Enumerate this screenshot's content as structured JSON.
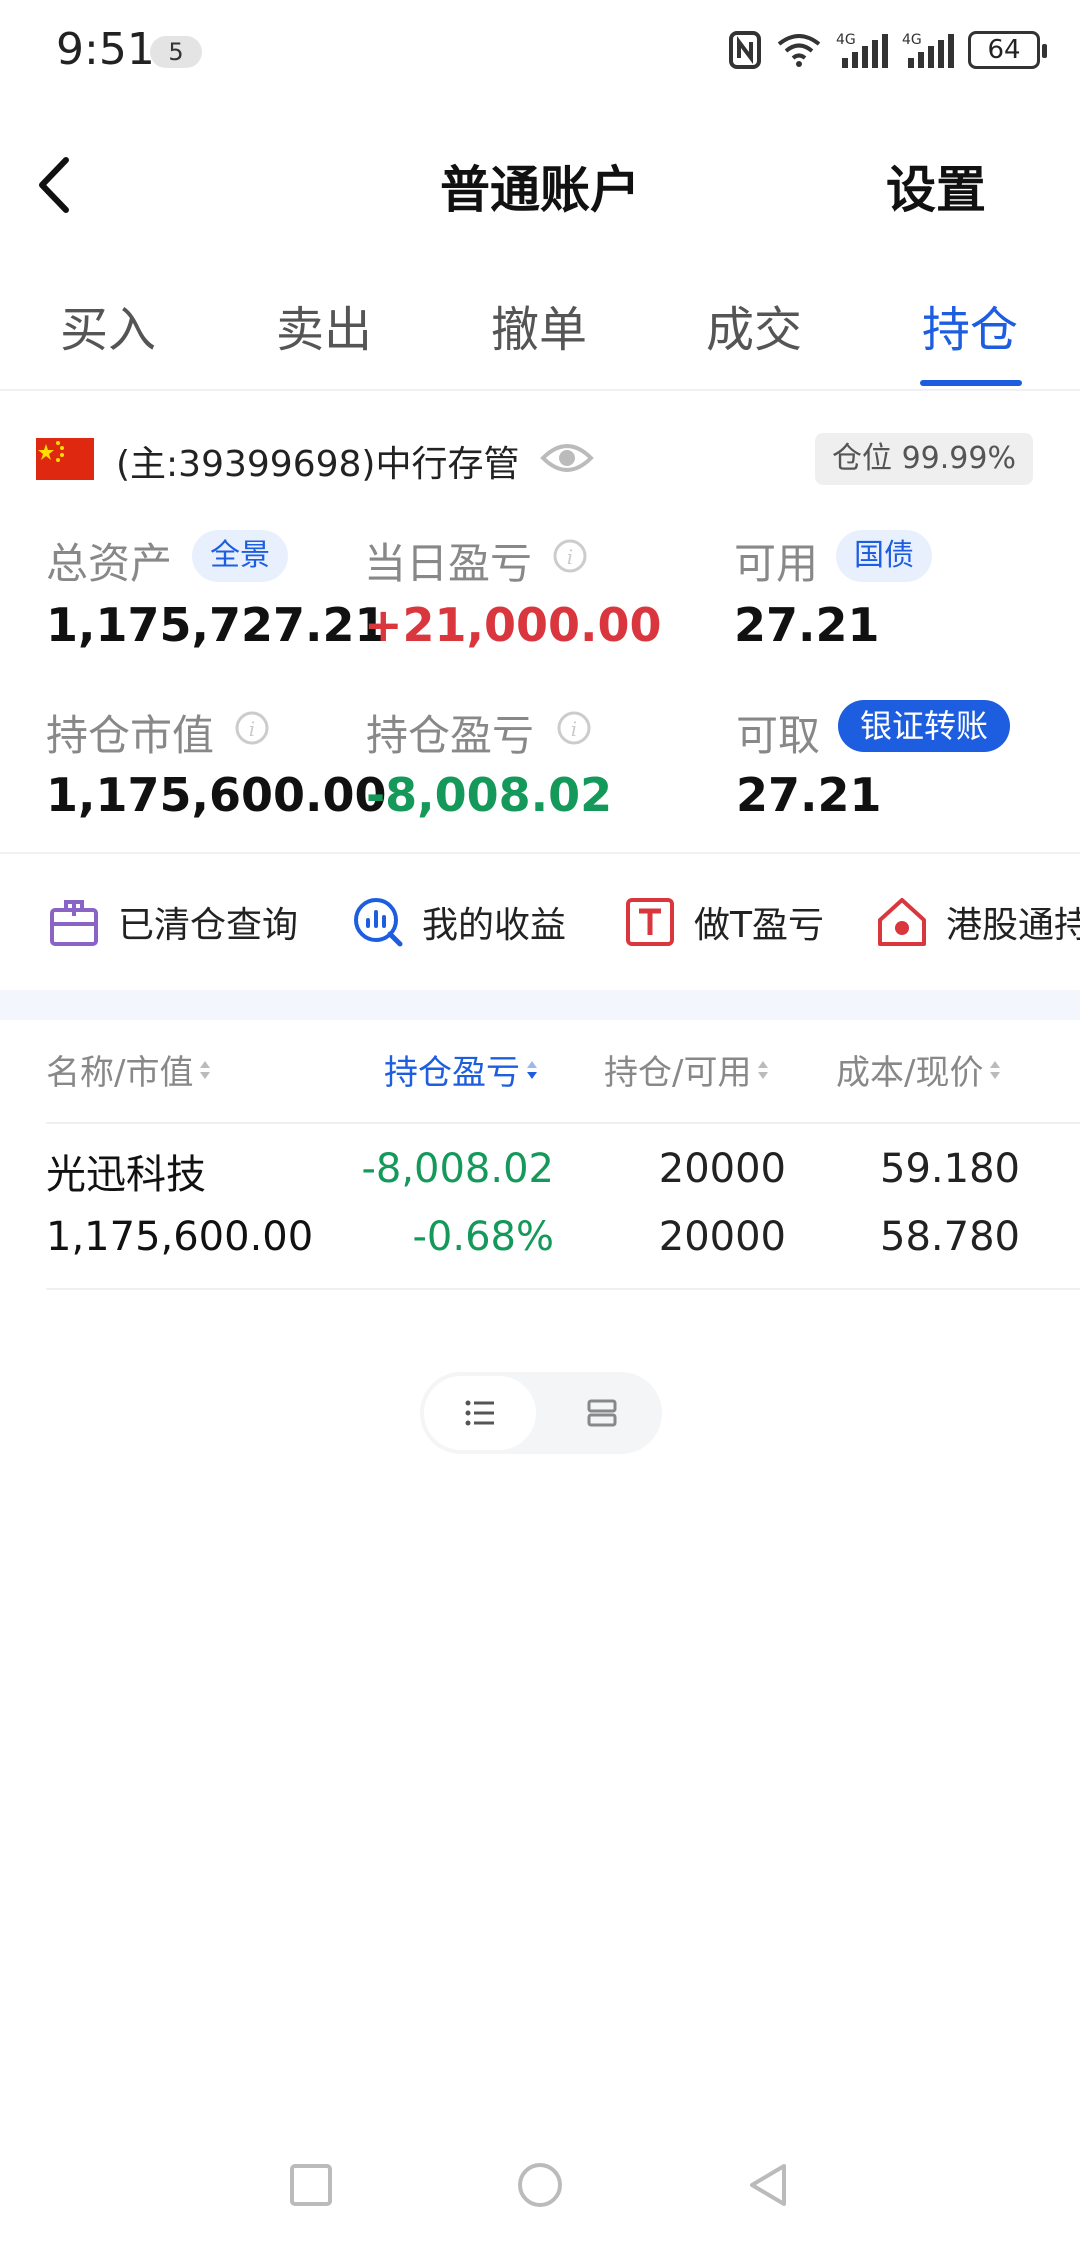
{
  "status": {
    "time": "9:51",
    "notif_count": "5",
    "battery": "64"
  },
  "header": {
    "title": "普通账户",
    "settings": "设置"
  },
  "tabs": [
    {
      "label": "买入"
    },
    {
      "label": "卖出"
    },
    {
      "label": "撤单"
    },
    {
      "label": "成交"
    },
    {
      "label": "持仓"
    }
  ],
  "account": {
    "label": "(主:39399698)中行存管",
    "position_ratio": "仓位 99.99%"
  },
  "stats": {
    "total_assets": {
      "label": "总资产",
      "badge": "全景",
      "value": "1,175,727.21"
    },
    "daily_pnl": {
      "label": "当日盈亏",
      "value": "+21,000.00"
    },
    "available": {
      "label": "可用",
      "badge": "国债",
      "value": "27.21"
    },
    "market_value": {
      "label": "持仓市值",
      "value": "1,175,600.00"
    },
    "position_pnl": {
      "label": "持仓盈亏",
      "value": "-8,008.02"
    },
    "withdrawable": {
      "label": "可取",
      "badge": "银证转账",
      "value": "27.21"
    }
  },
  "tools": [
    {
      "label": "已清仓查询"
    },
    {
      "label": "我的收益"
    },
    {
      "label": "做T盈亏"
    },
    {
      "label": "港股通持"
    }
  ],
  "table": {
    "headers": [
      "名称/市值",
      "持仓盈亏",
      "持仓/可用",
      "成本/现价"
    ],
    "rows": [
      {
        "name": "光迅科技",
        "market_value": "1,175,600.00",
        "pnl": "-8,008.02",
        "pnl_pct": "-0.68%",
        "holding": "20000",
        "available": "20000",
        "cost": "59.180",
        "price": "58.780"
      }
    ]
  },
  "colors": {
    "accent": "#1d5ee0",
    "gain": "#d9363e",
    "loss": "#14995a"
  }
}
